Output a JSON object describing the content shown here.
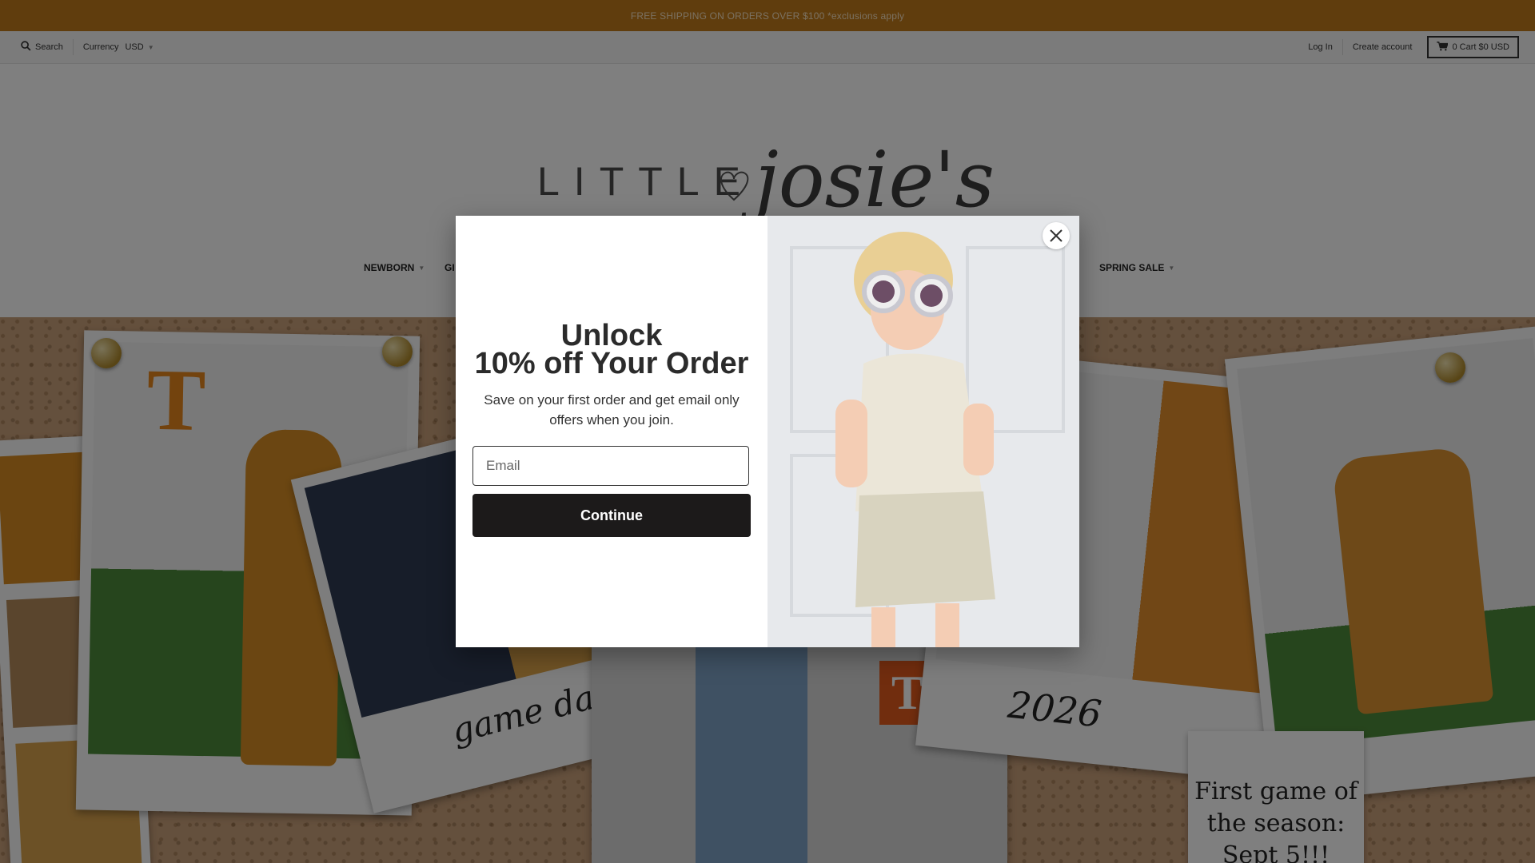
{
  "announcement": {
    "text": "FREE SHIPPING ON ORDERS OVER $100 *exclusions apply"
  },
  "utility_bar": {
    "search_label": "Search",
    "currency_label": "Currency",
    "currency_value": "USD",
    "login_label": "Log In",
    "create_account_label": "Create account",
    "cart_label": "0 Cart $0 USD"
  },
  "logo": {
    "text_left": "LITTLE",
    "text_right": "josie's"
  },
  "nav": {
    "items": [
      {
        "label": "NEWBORN"
      },
      {
        "label": "GI"
      },
      {
        "label": "SPRING SALE"
      }
    ]
  },
  "hero": {
    "caption_game_day": "game day!",
    "caption_year": "2026",
    "note_line1": "First game of",
    "note_line2": "the season:",
    "note_line3": "Sept 5!!!"
  },
  "modal": {
    "title_line1": "Unlock",
    "title_line2": "10% off Your Order",
    "subtitle": "Save on your first order and get email only offers when you join.",
    "email_placeholder": "Email",
    "continue_label": "Continue"
  },
  "colors": {
    "announcement_bg": "#c07a1a",
    "button_bg": "#1c1a1a",
    "overlay": "rgba(0,0,0,0.5)"
  }
}
